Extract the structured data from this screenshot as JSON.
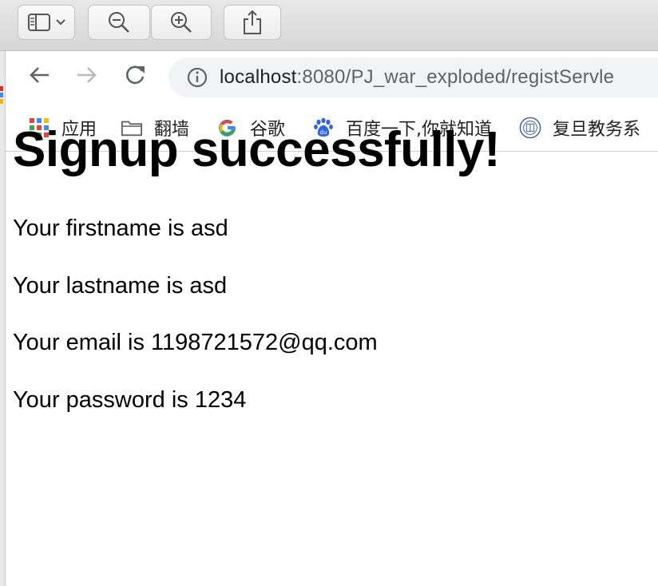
{
  "toolbar": {
    "buttons": [
      {
        "name": "sidebar-toggle",
        "icon": "sidebar-icon"
      },
      {
        "name": "zoom-out",
        "icon": "zoom-out-icon"
      },
      {
        "name": "zoom-in",
        "icon": "zoom-in-icon"
      },
      {
        "name": "share",
        "icon": "share-icon"
      }
    ]
  },
  "browser": {
    "nav": {
      "back_icon": "arrow-left-icon",
      "forward_icon": "arrow-right-icon",
      "reload_icon": "reload-icon"
    },
    "address": {
      "host": "localhost",
      "path": ":8080/PJ_war_exploded/registServle",
      "info_icon": "info-icon"
    },
    "bookmarks": [
      {
        "label": "应用",
        "icon": "apps-grid-icon"
      },
      {
        "label": "翻墙",
        "icon": "folder-icon"
      },
      {
        "label": "谷歌",
        "icon": "google-icon"
      },
      {
        "label": "百度一下,你就知道",
        "icon": "baidu-paw-icon"
      },
      {
        "label": "复旦教务系",
        "icon": "fudan-seal-icon"
      }
    ]
  },
  "content": {
    "heading": "Signup successfully!",
    "lines": [
      "Your firstname is asd",
      "Your lastname is asd",
      "Your email is 1198721572@qq.com",
      "Your password is 1234"
    ]
  },
  "colors": {
    "omnibox_bg": "#f1f3f4",
    "toolbar_bg": "#d6d6d6",
    "text": "#000000"
  }
}
